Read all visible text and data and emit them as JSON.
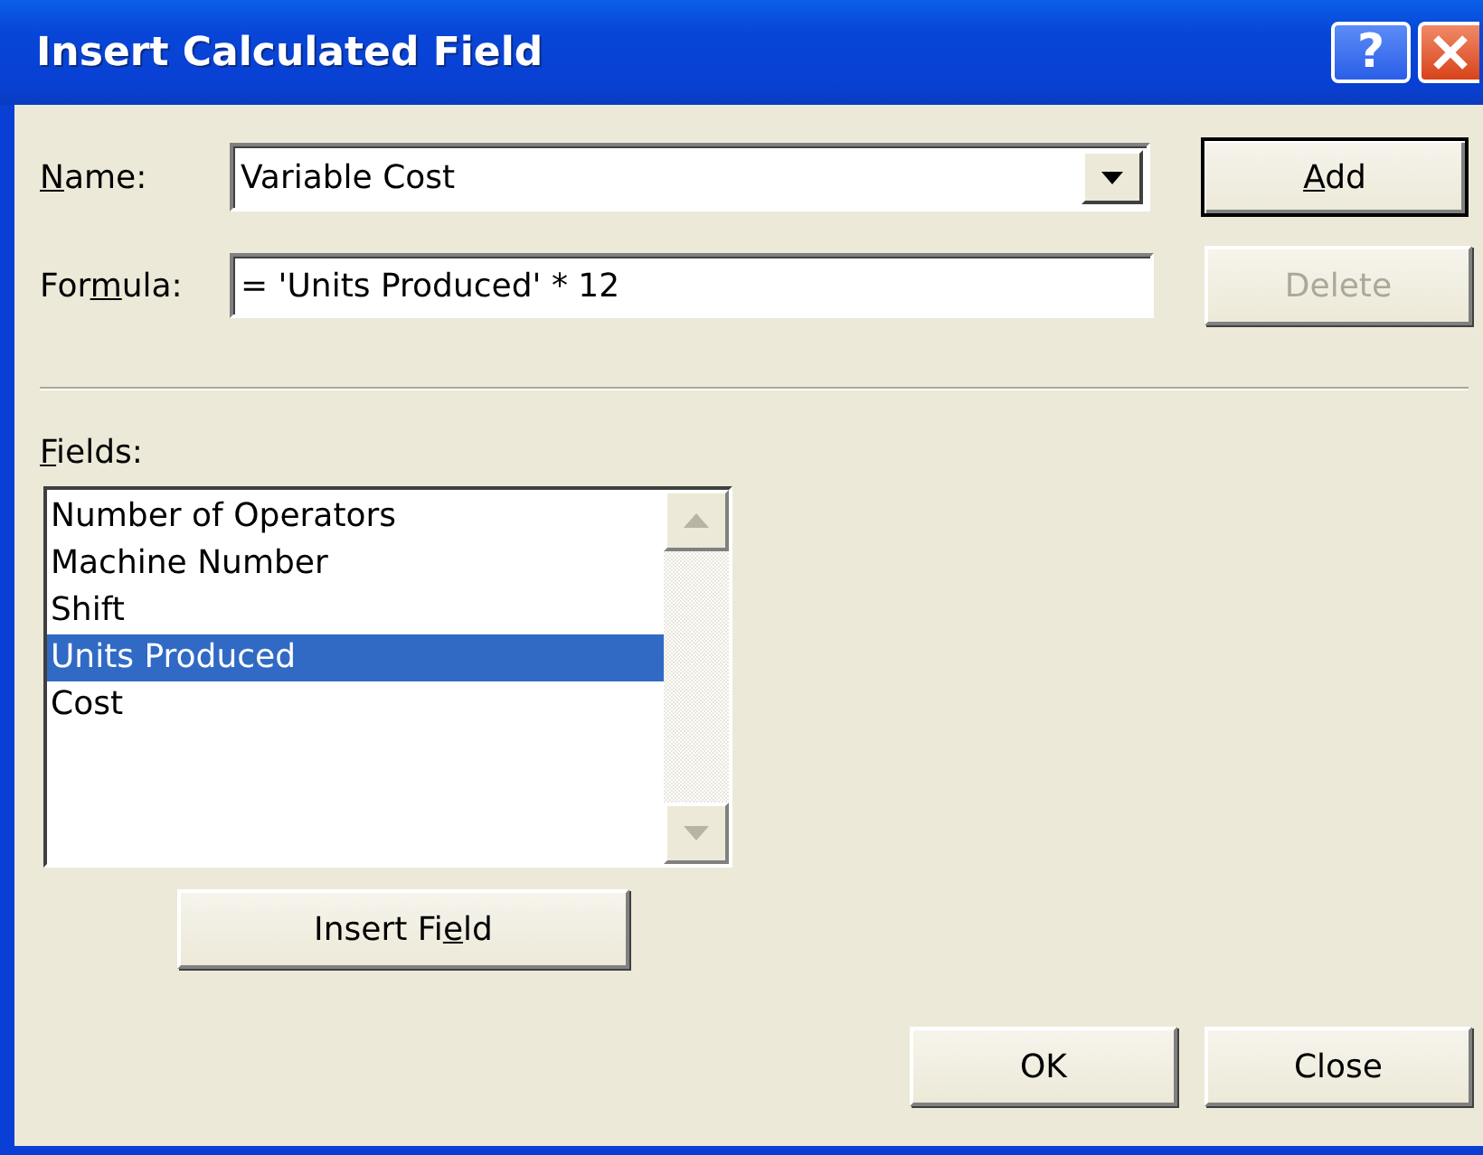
{
  "window": {
    "title": "Insert Calculated Field",
    "title_buttons": [
      {
        "kind": "help",
        "label": "?"
      },
      {
        "kind": "close"
      }
    ]
  },
  "name": {
    "label": {
      "key": "N",
      "after": "ame:"
    },
    "value": "Variable Cost"
  },
  "formula": {
    "label": {
      "before": "For",
      "key": "m",
      "after": "ula:"
    },
    "value": "= 'Units Produced' * 12"
  },
  "side_buttons": [
    {
      "label": {
        "key": "A",
        "after": "dd"
      },
      "default": true,
      "disabled": false
    },
    {
      "label": {
        "before": "Delete"
      },
      "default": false,
      "disabled": true
    }
  ],
  "fields": {
    "label": {
      "key": "F",
      "after": "ields:"
    },
    "items": [
      {
        "text": "Number of Operators",
        "selected": false
      },
      {
        "text": "Machine Number",
        "selected": false
      },
      {
        "text": "Shift",
        "selected": false
      },
      {
        "text": "Units Produced",
        "selected": true
      },
      {
        "text": "Cost",
        "selected": false
      }
    ]
  },
  "insert_button": {
    "label": {
      "before": "Insert Fi",
      "key": "e",
      "after": "ld"
    },
    "default": false,
    "disabled": false
  },
  "dialog_buttons": [
    {
      "label": {
        "before": "OK"
      },
      "default": false,
      "disabled": false
    },
    {
      "label": {
        "before": "Close"
      },
      "default": false,
      "disabled": false
    }
  ]
}
